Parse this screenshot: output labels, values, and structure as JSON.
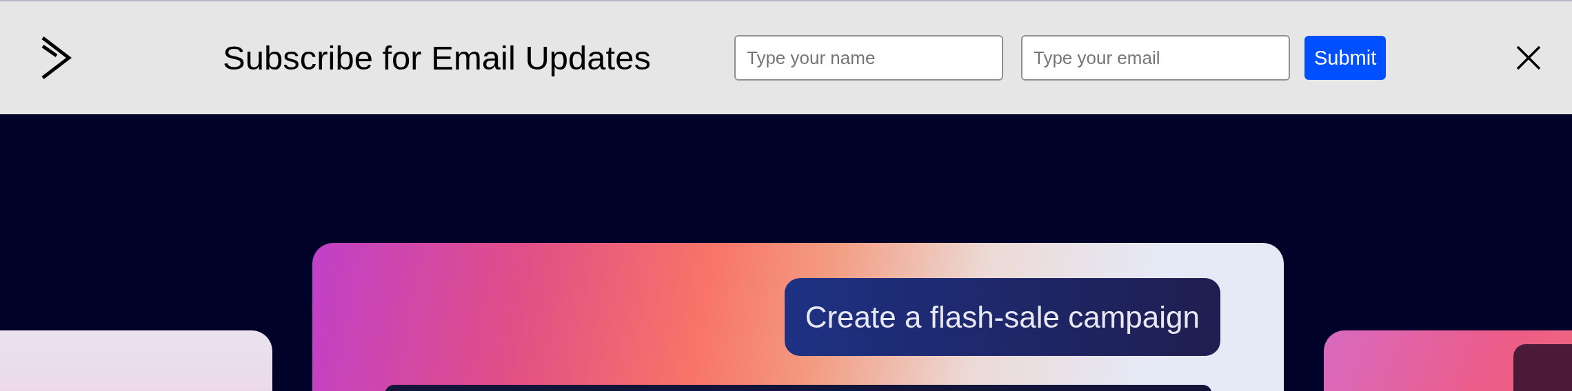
{
  "banner": {
    "title": "Subscribe for Email Updates",
    "name_field": {
      "placeholder": "Type your name"
    },
    "email_field": {
      "placeholder": "Type your email"
    },
    "submit_button": "Submit"
  },
  "hero": {
    "prompt_chip": "Create a flash-sale campaign"
  }
}
